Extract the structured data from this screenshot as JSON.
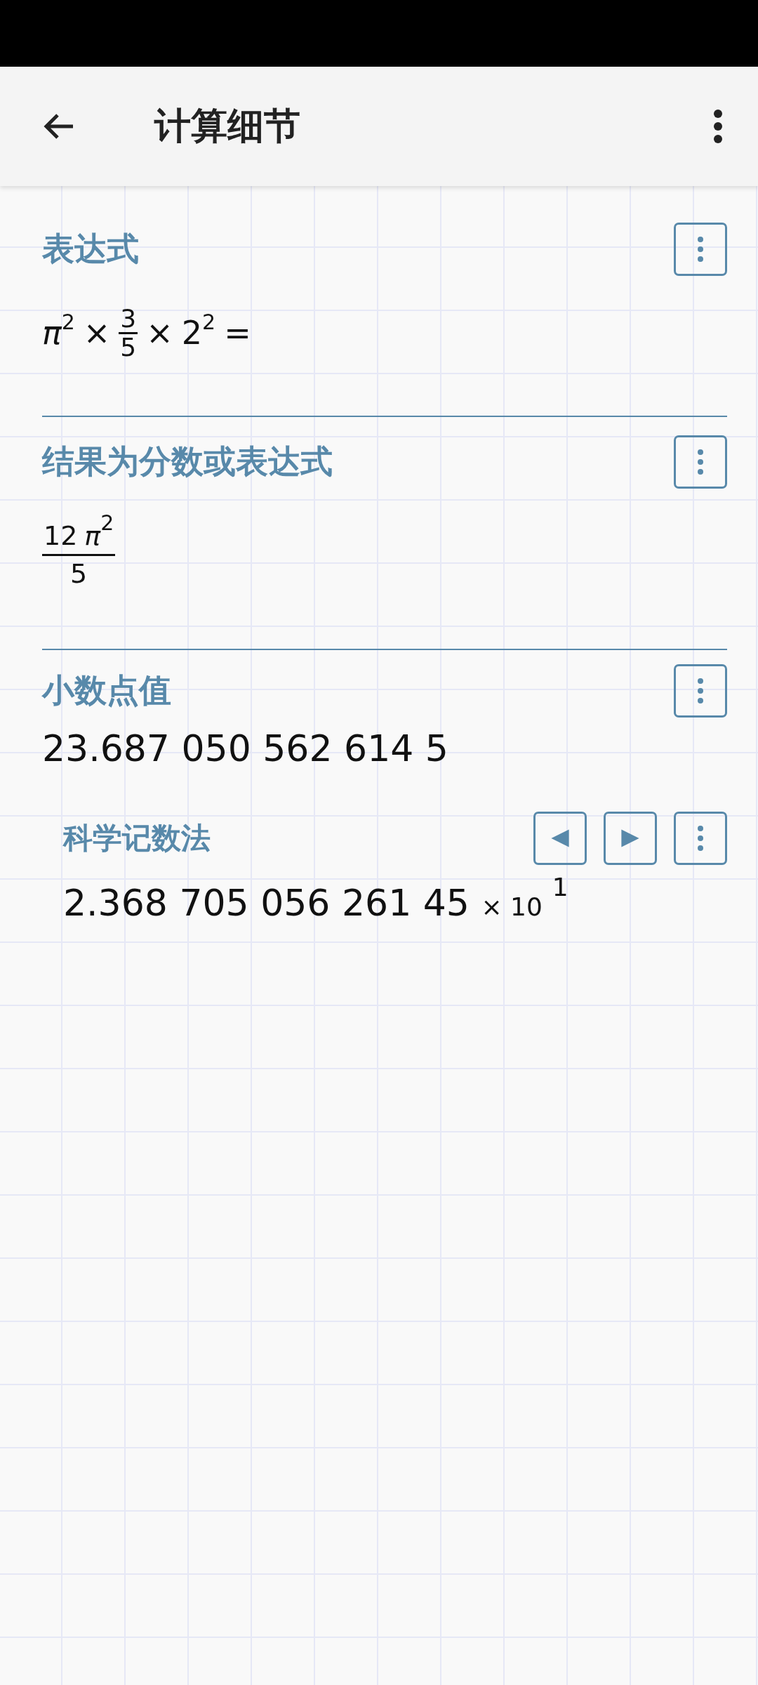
{
  "app_bar": {
    "title": "计算细节"
  },
  "sections": [
    {
      "kind": "expression",
      "label": "表达式",
      "tokens": [
        {
          "kind": "power",
          "base": "π",
          "italic": true,
          "exp": "2"
        },
        {
          "kind": "op",
          "text": "×"
        },
        {
          "kind": "frac",
          "num": [
            {
              "kind": "num",
              "text": "3"
            }
          ],
          "den": [
            {
              "kind": "num",
              "text": "5"
            }
          ]
        },
        {
          "kind": "op",
          "text": "×"
        },
        {
          "kind": "power",
          "base": "2",
          "italic": false,
          "exp": "2"
        },
        {
          "kind": "op",
          "text": "="
        }
      ]
    },
    {
      "kind": "fraction",
      "label": "结果为分数或表达式",
      "tokens": [
        {
          "kind": "bigfrac",
          "num": [
            {
              "kind": "num",
              "text": "12"
            },
            {
              "kind": "power",
              "base": "π",
              "italic": true,
              "exp": "2"
            }
          ],
          "den": [
            {
              "kind": "num",
              "text": "5"
            }
          ]
        }
      ]
    },
    {
      "kind": "decimal",
      "label": "小数点值",
      "value": "23.687 050 562 614 5"
    },
    {
      "kind": "scientific",
      "label": "科学记数法",
      "mantissa": "2.368 705 056 261 45",
      "times": "× 10",
      "exponent": "1"
    }
  ]
}
